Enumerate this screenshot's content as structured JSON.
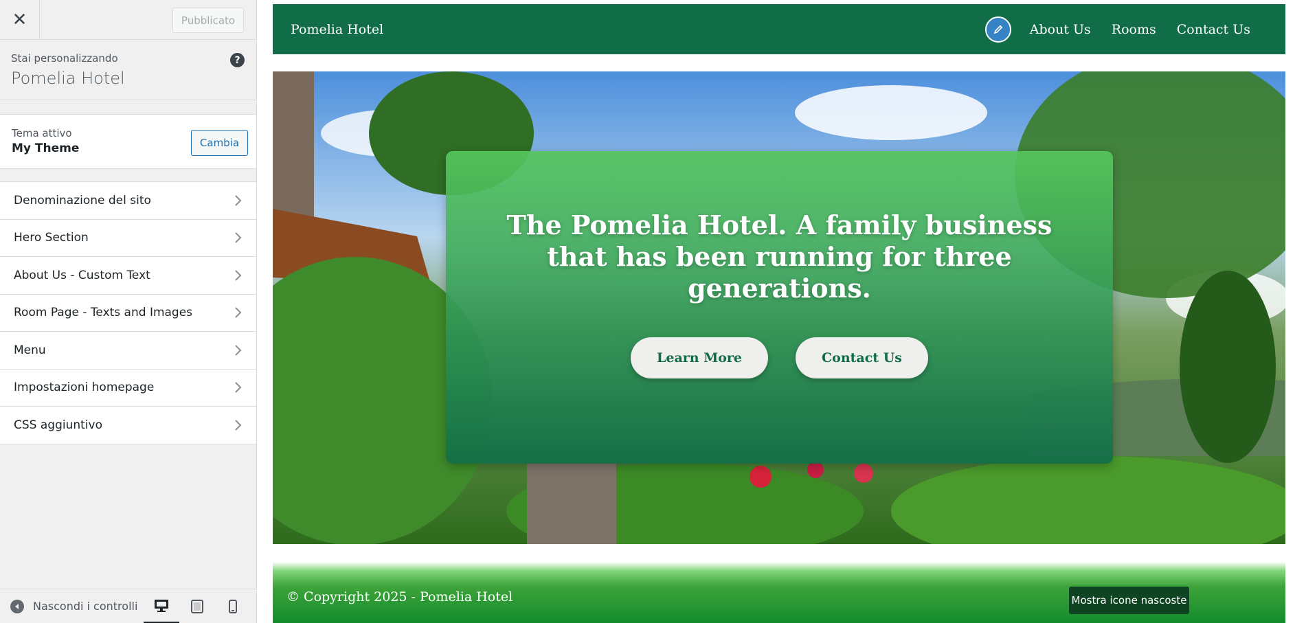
{
  "customizer": {
    "close_icon": "close-icon",
    "publish_label": "Pubblicato",
    "customizing_label": "Stai personalizzando",
    "site_name": "Pomelia Hotel",
    "help_icon": "help-icon",
    "active_theme_label": "Tema attivo",
    "theme_name": "My Theme",
    "change_label": "Cambia",
    "sections": [
      {
        "label": "Denominazione del sito"
      },
      {
        "label": "Hero Section"
      },
      {
        "label": "About Us - Custom Text"
      },
      {
        "label": "Room Page - Texts and Images"
      },
      {
        "label": "Menu"
      },
      {
        "label": "Impostazioni homepage"
      },
      {
        "label": "CSS aggiuntivo"
      }
    ],
    "hide_controls_label": "Nascondi i controlli",
    "devices": [
      "desktop-icon",
      "tablet-icon",
      "mobile-icon"
    ]
  },
  "preview": {
    "brand": "Pomelia Hotel",
    "nav": [
      "About Us",
      "Rooms",
      "Contact Us"
    ],
    "hero": {
      "title": "The Pomelia Hotel. A family business that has been running for three generations.",
      "buttons": [
        "Learn More",
        "Contact Us"
      ]
    },
    "footer_text": "© Copyright 2025 - Pomelia Hotel",
    "tooltip": "Mostra icone nascoste"
  },
  "colors": {
    "header_green": "#116d48",
    "accent_blue": "#2271b1",
    "hero_box_top": "#56c65c",
    "footer_green": "#138c2c"
  }
}
